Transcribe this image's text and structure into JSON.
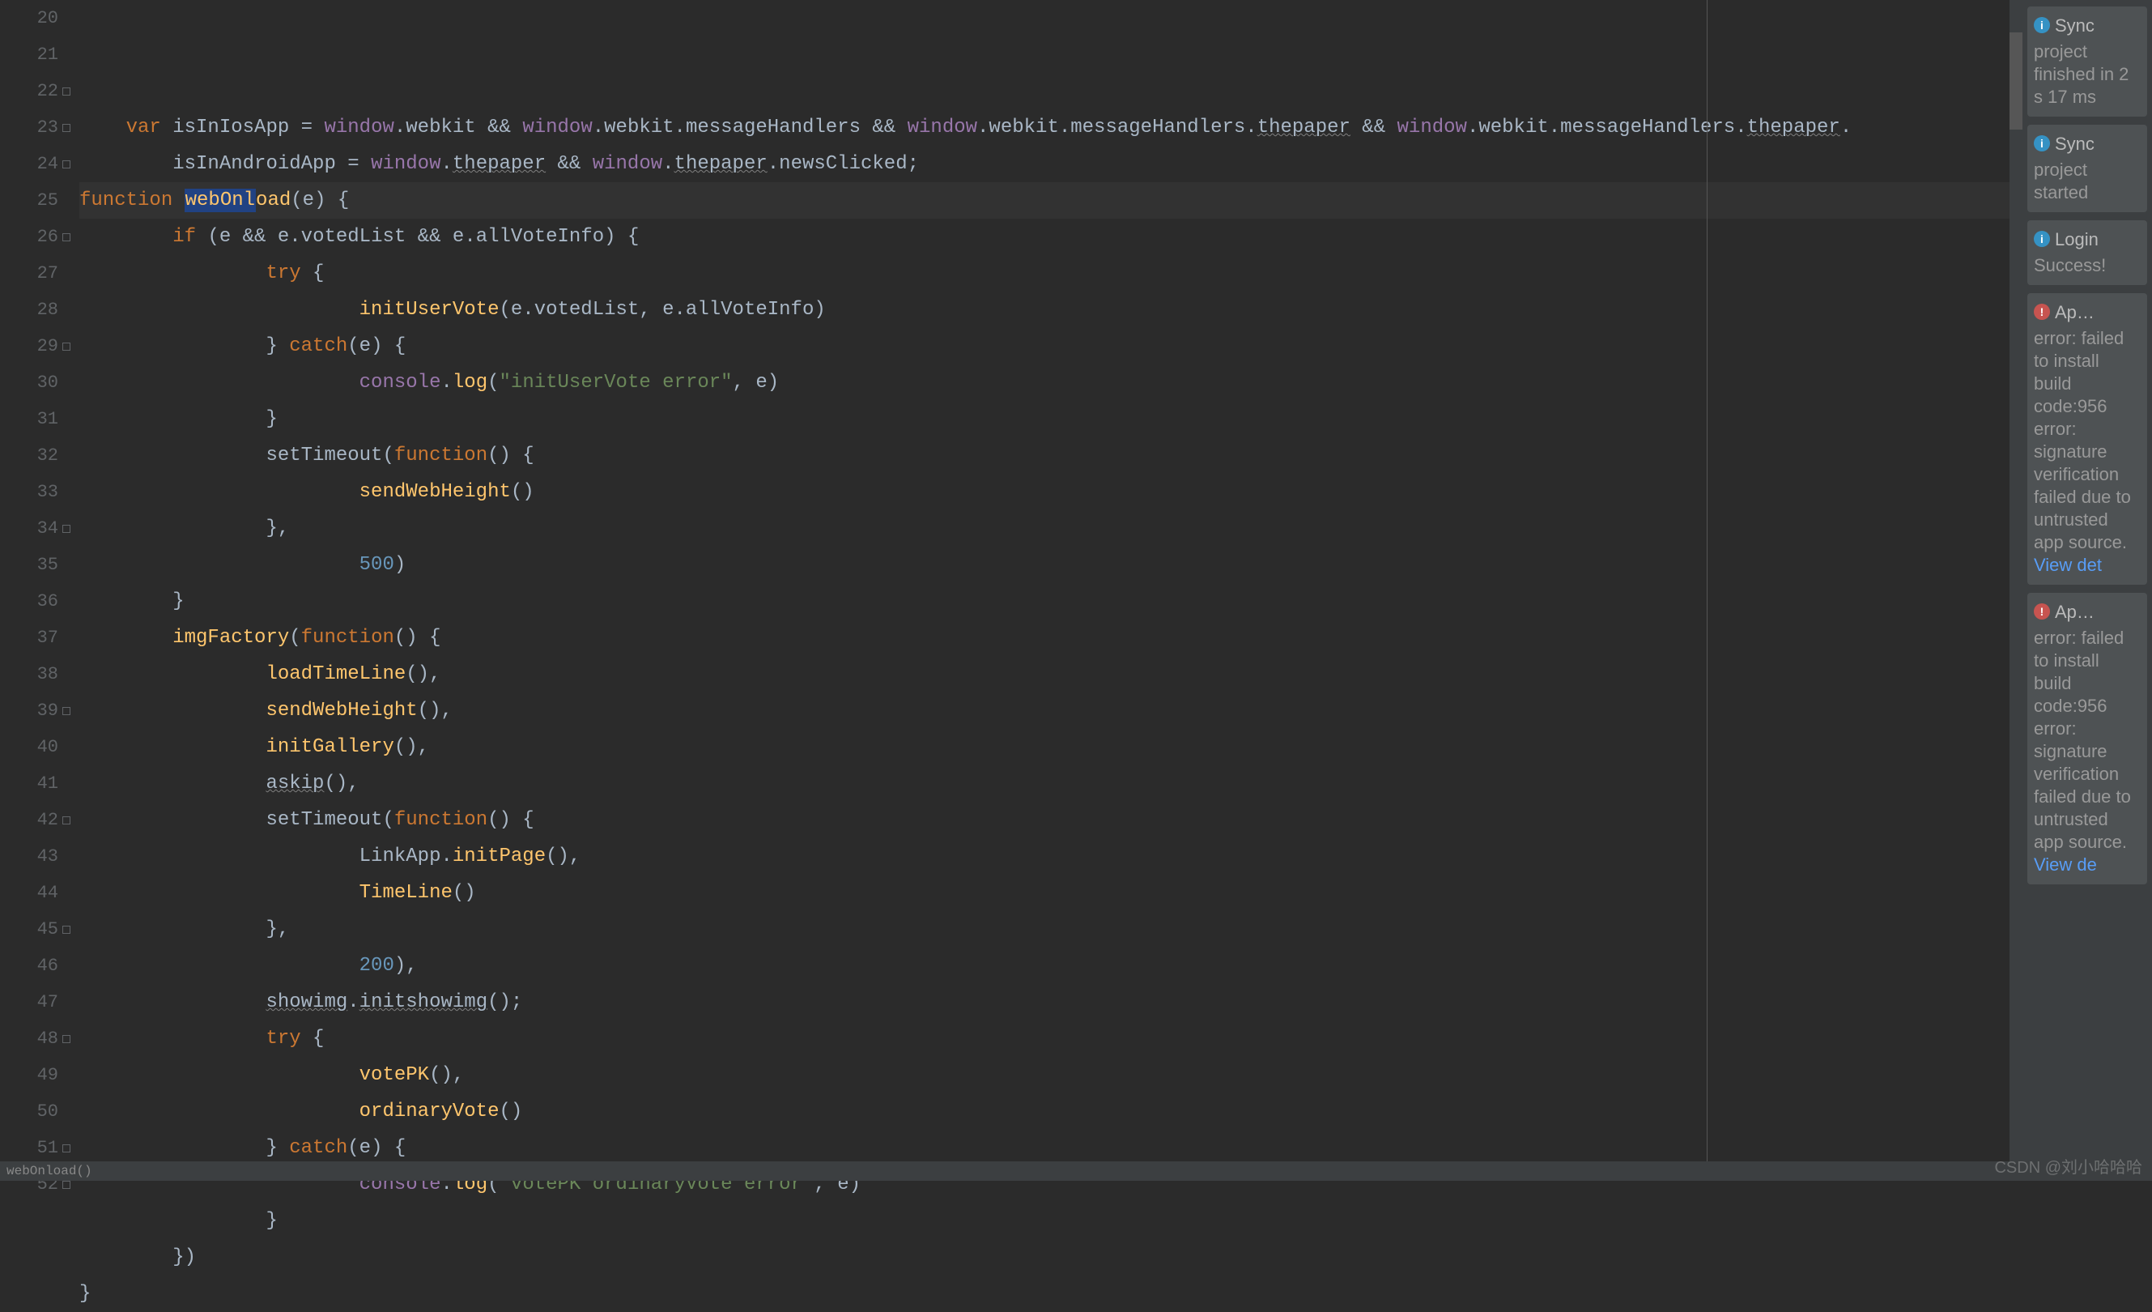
{
  "gutter": {
    "start": 20,
    "end": 52
  },
  "code": [
    {
      "n": 20,
      "indent": 1,
      "tokens": [
        {
          "t": "var ",
          "c": "kw"
        },
        {
          "t": "isInIosApp = ",
          "c": "pn"
        },
        {
          "t": "window",
          "c": "prop"
        },
        {
          "t": ".webkit && ",
          "c": "pn"
        },
        {
          "t": "window",
          "c": "prop"
        },
        {
          "t": ".webkit.messageHandlers && ",
          "c": "pn"
        },
        {
          "t": "window",
          "c": "prop"
        },
        {
          "t": ".webkit.messageHandlers.",
          "c": "pn"
        },
        {
          "t": "thepaper",
          "c": "wavy"
        },
        {
          "t": " && ",
          "c": "pn"
        },
        {
          "t": "window",
          "c": "prop"
        },
        {
          "t": ".webkit.messageHandlers.",
          "c": "pn"
        },
        {
          "t": "thepaper",
          "c": "wavy"
        },
        {
          "t": ".",
          "c": "pn"
        }
      ]
    },
    {
      "n": 21,
      "indent": 2,
      "tokens": [
        {
          "t": "isInAndroidApp = ",
          "c": "pn"
        },
        {
          "t": "window",
          "c": "prop"
        },
        {
          "t": ".",
          "c": "pn"
        },
        {
          "t": "thepaper",
          "c": "wavy"
        },
        {
          "t": " && ",
          "c": "pn"
        },
        {
          "t": "window",
          "c": "prop"
        },
        {
          "t": ".",
          "c": "pn"
        },
        {
          "t": "thepaper",
          "c": "wavy"
        },
        {
          "t": ".newsClicked;",
          "c": "pn"
        }
      ]
    },
    {
      "n": 22,
      "indent": 0,
      "hl": true,
      "tokens": [
        {
          "t": "function ",
          "c": "kw"
        },
        {
          "t": "webOnl",
          "c": "fn sel"
        },
        {
          "t": "oad",
          "c": "fn"
        },
        {
          "t": "(",
          "c": "pn"
        },
        {
          "t": "e",
          "c": "pn"
        },
        {
          "t": ") {",
          "c": "pn"
        }
      ]
    },
    {
      "n": 23,
      "indent": 2,
      "tokens": [
        {
          "t": "if ",
          "c": "kw"
        },
        {
          "t": "(",
          "c": "pn"
        },
        {
          "t": "e",
          "c": "pn"
        },
        {
          "t": " && ",
          "c": "pn"
        },
        {
          "t": "e",
          "c": "pn"
        },
        {
          "t": ".votedList && ",
          "c": "pn"
        },
        {
          "t": "e",
          "c": "pn"
        },
        {
          "t": ".allVoteInfo) {",
          "c": "pn"
        }
      ]
    },
    {
      "n": 24,
      "indent": 4,
      "tokens": [
        {
          "t": "try ",
          "c": "kw"
        },
        {
          "t": "{",
          "c": "pn"
        }
      ]
    },
    {
      "n": 25,
      "indent": 6,
      "tokens": [
        {
          "t": "initUserVote",
          "c": "fn"
        },
        {
          "t": "(",
          "c": "pn"
        },
        {
          "t": "e",
          "c": "pn"
        },
        {
          "t": ".votedList, ",
          "c": "pn"
        },
        {
          "t": "e",
          "c": "pn"
        },
        {
          "t": ".allVoteInfo)",
          "c": "pn"
        }
      ]
    },
    {
      "n": 26,
      "indent": 4,
      "tokens": [
        {
          "t": "} ",
          "c": "pn"
        },
        {
          "t": "catch",
          "c": "kw"
        },
        {
          "t": "(",
          "c": "pn"
        },
        {
          "t": "e",
          "c": "pn"
        },
        {
          "t": ") {",
          "c": "pn"
        }
      ]
    },
    {
      "n": 27,
      "indent": 6,
      "tokens": [
        {
          "t": "console",
          "c": "prop"
        },
        {
          "t": ".",
          "c": "pn"
        },
        {
          "t": "log",
          "c": "fn"
        },
        {
          "t": "(",
          "c": "pn"
        },
        {
          "t": "\"initUserVote error\"",
          "c": "str"
        },
        {
          "t": ", ",
          "c": "pn"
        },
        {
          "t": "e",
          "c": "pn"
        },
        {
          "t": ")",
          "c": "pn"
        }
      ]
    },
    {
      "n": 28,
      "indent": 4,
      "tokens": [
        {
          "t": "}",
          "c": "pn"
        }
      ]
    },
    {
      "n": 29,
      "indent": 4,
      "tokens": [
        {
          "t": "setTimeout(",
          "c": "pn"
        },
        {
          "t": "function",
          "c": "kw"
        },
        {
          "t": "() {",
          "c": "pn"
        }
      ]
    },
    {
      "n": 30,
      "indent": 6,
      "tokens": [
        {
          "t": "sendWebHeight",
          "c": "fn"
        },
        {
          "t": "()",
          "c": "pn"
        }
      ]
    },
    {
      "n": 31,
      "indent": 4,
      "tokens": [
        {
          "t": "},",
          "c": "pn"
        }
      ]
    },
    {
      "n": 32,
      "indent": 6,
      "tokens": [
        {
          "t": "500",
          "c": "num"
        },
        {
          "t": ")",
          "c": "pn"
        }
      ]
    },
    {
      "n": 33,
      "indent": 2,
      "tokens": [
        {
          "t": "}",
          "c": "pn"
        }
      ]
    },
    {
      "n": 34,
      "indent": 2,
      "tokens": [
        {
          "t": "imgFactory",
          "c": "fn"
        },
        {
          "t": "(",
          "c": "pn"
        },
        {
          "t": "function",
          "c": "kw"
        },
        {
          "t": "() {",
          "c": "pn"
        }
      ]
    },
    {
      "n": 35,
      "indent": 4,
      "tokens": [
        {
          "t": "loadTimeLine",
          "c": "fn"
        },
        {
          "t": "(),",
          "c": "pn"
        }
      ]
    },
    {
      "n": 36,
      "indent": 4,
      "tokens": [
        {
          "t": "sendWebHeight",
          "c": "fn"
        },
        {
          "t": "(),",
          "c": "pn"
        }
      ]
    },
    {
      "n": 37,
      "indent": 4,
      "tokens": [
        {
          "t": "initGallery",
          "c": "fn"
        },
        {
          "t": "(),",
          "c": "pn"
        }
      ]
    },
    {
      "n": 38,
      "indent": 4,
      "tokens": [
        {
          "t": "askip",
          "c": "wavy"
        },
        {
          "t": "(),",
          "c": "pn"
        }
      ]
    },
    {
      "n": 39,
      "indent": 4,
      "tokens": [
        {
          "t": "setTimeout(",
          "c": "pn"
        },
        {
          "t": "function",
          "c": "kw"
        },
        {
          "t": "() {",
          "c": "pn"
        }
      ]
    },
    {
      "n": 40,
      "indent": 6,
      "tokens": [
        {
          "t": "LinkApp.",
          "c": "pn"
        },
        {
          "t": "initPage",
          "c": "fn"
        },
        {
          "t": "(),",
          "c": "pn"
        }
      ]
    },
    {
      "n": 41,
      "indent": 6,
      "tokens": [
        {
          "t": "TimeLine",
          "c": "fn"
        },
        {
          "t": "()",
          "c": "pn"
        }
      ]
    },
    {
      "n": 42,
      "indent": 4,
      "tokens": [
        {
          "t": "},",
          "c": "pn"
        }
      ]
    },
    {
      "n": 43,
      "indent": 6,
      "tokens": [
        {
          "t": "200",
          "c": "num"
        },
        {
          "t": "),",
          "c": "pn"
        }
      ]
    },
    {
      "n": 44,
      "indent": 4,
      "tokens": [
        {
          "t": "showimg",
          "c": "wavy"
        },
        {
          "t": ".",
          "c": "pn"
        },
        {
          "t": "initshowimg",
          "c": "wavy"
        },
        {
          "t": "();",
          "c": "pn"
        }
      ]
    },
    {
      "n": 45,
      "indent": 4,
      "tokens": [
        {
          "t": "try ",
          "c": "kw"
        },
        {
          "t": "{",
          "c": "pn"
        }
      ]
    },
    {
      "n": 46,
      "indent": 6,
      "tokens": [
        {
          "t": "votePK",
          "c": "fn"
        },
        {
          "t": "(),",
          "c": "pn"
        }
      ]
    },
    {
      "n": 47,
      "indent": 6,
      "tokens": [
        {
          "t": "ordinaryVote",
          "c": "fn"
        },
        {
          "t": "()",
          "c": "pn"
        }
      ]
    },
    {
      "n": 48,
      "indent": 4,
      "tokens": [
        {
          "t": "} ",
          "c": "pn"
        },
        {
          "t": "catch",
          "c": "kw"
        },
        {
          "t": "(",
          "c": "pn"
        },
        {
          "t": "e",
          "c": "pn"
        },
        {
          "t": ") {",
          "c": "pn"
        }
      ]
    },
    {
      "n": 49,
      "indent": 6,
      "tokens": [
        {
          "t": "console",
          "c": "prop"
        },
        {
          "t": ".",
          "c": "pn"
        },
        {
          "t": "log",
          "c": "fn"
        },
        {
          "t": "(",
          "c": "pn"
        },
        {
          "t": "\"votePK ordinaryVote error\"",
          "c": "str"
        },
        {
          "t": ", ",
          "c": "pn"
        },
        {
          "t": "e",
          "c": "pn"
        },
        {
          "t": ")",
          "c": "pn"
        }
      ]
    },
    {
      "n": 50,
      "indent": 4,
      "tokens": [
        {
          "t": "}",
          "c": "pn"
        }
      ]
    },
    {
      "n": 51,
      "indent": 2,
      "tokens": [
        {
          "t": "})",
          "c": "pn"
        }
      ]
    },
    {
      "n": 52,
      "indent": 0,
      "tokens": [
        {
          "t": "}",
          "c": "pn"
        }
      ]
    }
  ],
  "fold_marks": [
    22,
    23,
    24,
    26,
    29,
    34,
    39,
    42,
    45,
    48,
    51,
    52
  ],
  "notifications": [
    {
      "type": "info",
      "title": "Sync",
      "body": "project finished in 2 s 17 ms"
    },
    {
      "type": "info",
      "title": "Sync",
      "body": "project started"
    },
    {
      "type": "info",
      "title": "Login",
      "body": "Success!"
    },
    {
      "type": "error",
      "title": "Ap…",
      "body": "error: failed to install build code:956 error: signature verification failed due to untrusted app source.",
      "link": "View det"
    },
    {
      "type": "error",
      "title": "Ap…",
      "body": "error: failed to install build code:956 error: signature verification failed due to untrusted app source.",
      "link": "View de"
    }
  ],
  "status": {
    "text": "webOnload()"
  },
  "watermark": "CSDN @刘小哈哈哈"
}
